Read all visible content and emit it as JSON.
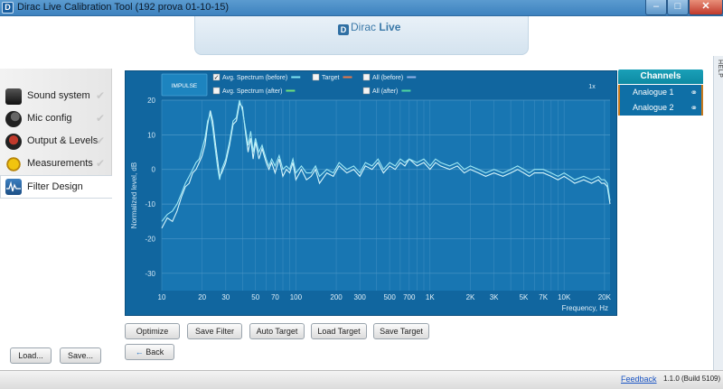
{
  "window": {
    "title": "Dirac Live Calibration Tool (192 prova 01-10-15)",
    "icon_letter": "D",
    "min": "–",
    "max": "□",
    "close": "✕"
  },
  "header": {
    "logo_icon": "D",
    "logo_dirac": "Dirac",
    "logo_live": "Live"
  },
  "help": {
    "label": "HELP"
  },
  "sidebar": {
    "items": [
      {
        "label": "Sound system",
        "icon": "speaker-icon",
        "check": "✔"
      },
      {
        "label": "Mic config",
        "icon": "microphone-icon",
        "check": "✔"
      },
      {
        "label": "Output & Levels",
        "icon": "level-knob-icon",
        "check": "✔"
      },
      {
        "label": "Measurements",
        "icon": "measuring-tape-icon",
        "check": "✔"
      },
      {
        "label": "Filter Design",
        "icon": "waveform-icon"
      }
    ],
    "load_label": "Load...",
    "save_label": "Save..."
  },
  "chart_controls": {
    "impulse_label": "IMPULSE",
    "zoom": "1x",
    "legend": [
      {
        "label": "Avg. Spectrum (before)",
        "checked": true,
        "color": "#7fe3f0"
      },
      {
        "label": "Target",
        "checked": false,
        "color": "#e8784a"
      },
      {
        "label": "All (before)",
        "checked": false,
        "color": "#8fb0e6"
      },
      {
        "label": "Avg. Spectrum (after)",
        "checked": false,
        "color": "#6fe07a"
      },
      {
        "label": "All (after)",
        "checked": false,
        "color": "#4fd6a0"
      }
    ]
  },
  "chart_data": {
    "type": "line",
    "title": "",
    "xlabel": "Frequency, Hz",
    "ylabel": "Normalized level, dB",
    "xscale": "log",
    "xlim": [
      10,
      22000
    ],
    "ylim": [
      -35,
      20
    ],
    "yticks": [
      20,
      10,
      0,
      -10,
      -20,
      -30
    ],
    "xticks": [
      {
        "value": 10,
        "label": "10"
      },
      {
        "value": 20,
        "label": "20"
      },
      {
        "value": 30,
        "label": "30"
      },
      {
        "value": 50,
        "label": "50"
      },
      {
        "value": 70,
        "label": "70"
      },
      {
        "value": 100,
        "label": "100"
      },
      {
        "value": 200,
        "label": "200"
      },
      {
        "value": 300,
        "label": "300"
      },
      {
        "value": 500,
        "label": "500"
      },
      {
        "value": 700,
        "label": "700"
      },
      {
        "value": 1000,
        "label": "1K"
      },
      {
        "value": 2000,
        "label": "2K"
      },
      {
        "value": 3000,
        "label": "3K"
      },
      {
        "value": 5000,
        "label": "5K"
      },
      {
        "value": 7000,
        "label": "7K"
      },
      {
        "value": 10000,
        "label": "10K"
      },
      {
        "value": 20000,
        "label": "20K"
      }
    ],
    "grid": true,
    "series": [
      {
        "color": "#d9f6fb",
        "x": [
          10,
          11,
          12,
          13,
          14,
          15,
          16,
          17,
          18,
          19,
          20,
          21,
          22,
          23,
          24,
          25,
          26,
          27,
          28,
          30,
          32,
          34,
          36,
          38,
          40,
          42,
          44,
          46,
          48,
          50,
          53,
          56,
          60,
          63,
          66,
          70,
          75,
          80,
          85,
          90,
          95,
          100,
          110,
          120,
          130,
          140,
          150,
          170,
          190,
          210,
          240,
          270,
          300,
          330,
          370,
          410,
          450,
          500,
          550,
          600,
          650,
          700,
          800,
          900,
          1000,
          1100,
          1200,
          1400,
          1600,
          1800,
          2000,
          2300,
          2600,
          3000,
          3500,
          4000,
          4500,
          5000,
          5500,
          6000,
          7000,
          8000,
          9000,
          10000,
          11000,
          12000,
          14000,
          16000,
          18000,
          19000,
          20000,
          21000,
          22000
        ],
        "y": [
          -17,
          -14,
          -15,
          -12,
          -8,
          -5,
          -4,
          -1,
          0,
          2,
          4,
          7,
          13,
          17,
          14,
          8,
          3,
          -2,
          -1,
          2,
          7,
          13,
          14,
          19,
          18,
          11,
          5,
          9,
          3,
          8,
          3,
          6,
          2,
          0,
          2,
          -1,
          3,
          -2,
          0,
          -1,
          2,
          -3,
          0,
          -3,
          -2,
          0,
          -4,
          -1,
          -2,
          1,
          -1,
          0,
          -2,
          1,
          0,
          2,
          -1,
          1,
          0,
          2,
          1,
          3,
          1,
          2,
          0,
          2,
          1,
          0,
          1,
          -1,
          0,
          -1,
          -2,
          -1,
          -2,
          -1,
          0,
          -1,
          -2,
          -1,
          -1,
          -2,
          -3,
          -2,
          -3,
          -4,
          -3,
          -4,
          -3,
          -4,
          -4,
          -5,
          -10
        ]
      },
      {
        "color": "#9fe9f5",
        "x": [
          10,
          11,
          12,
          13,
          14,
          15,
          16,
          17,
          18,
          19,
          20,
          21,
          22,
          23,
          24,
          25,
          26,
          27,
          28,
          30,
          32,
          34,
          36,
          38,
          40,
          42,
          44,
          46,
          48,
          50,
          53,
          56,
          60,
          63,
          66,
          70,
          75,
          80,
          85,
          90,
          95,
          100,
          110,
          120,
          130,
          140,
          150,
          170,
          190,
          210,
          240,
          270,
          300,
          330,
          370,
          410,
          450,
          500,
          550,
          600,
          650,
          700,
          800,
          900,
          1000,
          1100,
          1200,
          1400,
          1600,
          1800,
          2000,
          2300,
          2600,
          3000,
          3500,
          4000,
          4500,
          5000,
          5500,
          6000,
          7000,
          8000,
          9000,
          10000,
          11000,
          12000,
          14000,
          16000,
          18000,
          19000,
          20000,
          21000,
          22000
        ],
        "y": [
          -15,
          -13,
          -12,
          -10,
          -7,
          -4,
          -2,
          0,
          2,
          3,
          6,
          9,
          14,
          16,
          12,
          6,
          1,
          -3,
          0,
          3,
          8,
          14,
          15,
          20,
          17,
          12,
          7,
          11,
          5,
          9,
          5,
          7,
          3,
          1,
          3,
          1,
          4,
          0,
          1,
          0,
          3,
          -1,
          1,
          -1,
          -1,
          1,
          -2,
          0,
          -1,
          2,
          0,
          1,
          -1,
          2,
          1,
          3,
          0,
          2,
          1,
          3,
          2,
          3,
          2,
          3,
          1,
          3,
          2,
          1,
          2,
          0,
          1,
          0,
          -1,
          0,
          -1,
          0,
          1,
          0,
          -1,
          0,
          0,
          -1,
          -2,
          -1,
          -2,
          -3,
          -2,
          -3,
          -2,
          -3,
          -3,
          -4,
          -9
        ]
      }
    ]
  },
  "channels": {
    "header": "Channels",
    "items": [
      {
        "label": "Analogue 1",
        "link": "⚭"
      },
      {
        "label": "Analogue 2",
        "link": "⚭"
      }
    ]
  },
  "actions": {
    "optimize": "Optimize",
    "save_filter": "Save Filter",
    "auto_target": "Auto Target",
    "load_target": "Load Target",
    "save_target": "Save Target",
    "back": "Back",
    "back_arrow": "←"
  },
  "status": {
    "feedback": "Feedback",
    "version": "1.1.0 (Build 5109)"
  }
}
